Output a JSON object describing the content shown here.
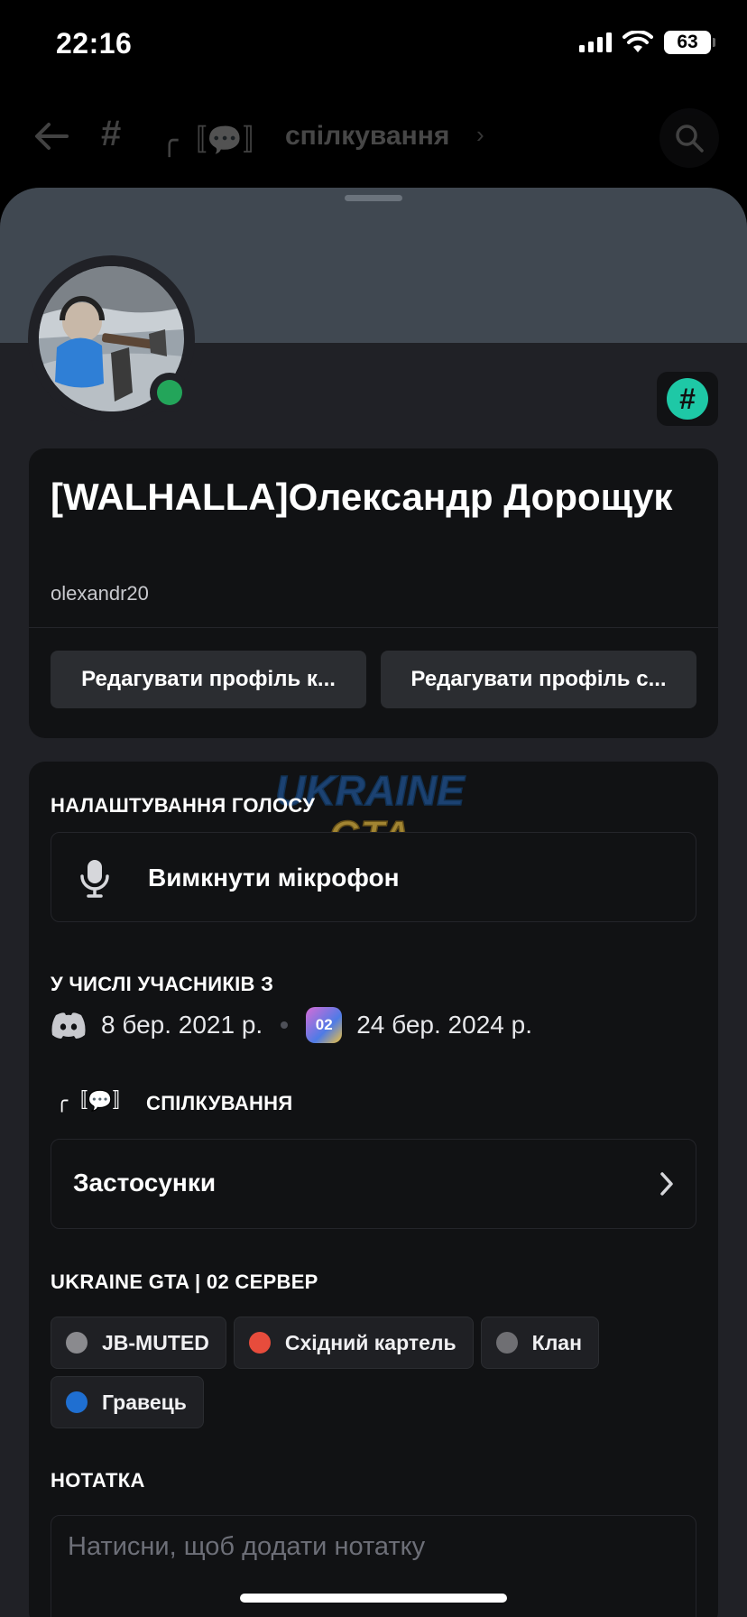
{
  "status_bar": {
    "time": "22:16",
    "battery": "63"
  },
  "channel_header": {
    "prefix": "╭〚💬〛",
    "name": "спілкування",
    "chevron": "›"
  },
  "profile": {
    "badge_symbol": "#",
    "display_name": "[WALHALLA]Олександр Дорощук",
    "username": "olexandr20",
    "edit_buttons": [
      "Редагувати профіль к...",
      "Редагувати профіль с..."
    ]
  },
  "voice": {
    "title": "НАЛАШТУВАННЯ ГОЛОСУ",
    "mute_label": "Вимкнути мікрофон"
  },
  "watermark": {
    "line1": "UKRAINE",
    "line2": "GTA"
  },
  "membership": {
    "title": "У ЧИСЛІ УЧАСНИКІВ З",
    "discord_date": "8 бер. 2021 р.",
    "server_icon_text": "02",
    "server_date": "24 бер. 2024 р."
  },
  "channel_section": {
    "prefix": "╭〚💬〛",
    "title": "СПІЛКУВАННЯ",
    "apps_label": "Застосунки"
  },
  "roles_section": {
    "title": "UKRAINE GTA | 02 СЕРВЕР",
    "roles": [
      {
        "name": "JB-MUTED",
        "color": "#8a8a8e"
      },
      {
        "name": "Східний картель",
        "color": "#e74c3c"
      },
      {
        "name": "Клан",
        "color": "#6f6f73"
      },
      {
        "name": "Гравець",
        "color": "#1f6fd1"
      }
    ]
  },
  "note": {
    "title": "НОТАТКА",
    "placeholder": "Натисни, щоб додати нотатку"
  }
}
